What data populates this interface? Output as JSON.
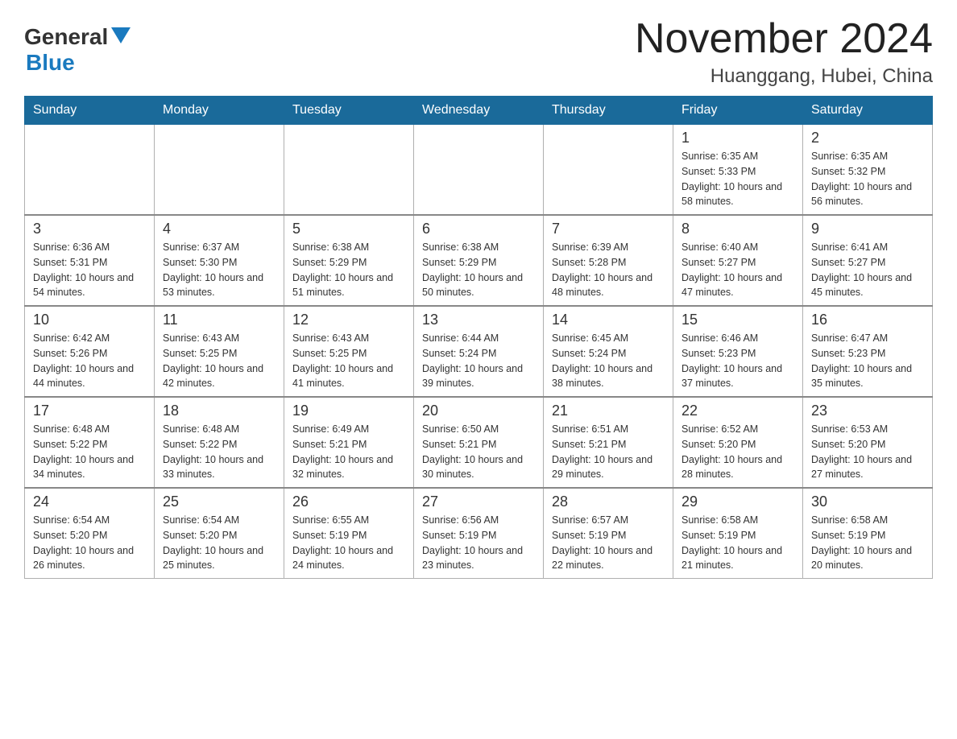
{
  "header": {
    "logo_general": "General",
    "logo_blue": "Blue",
    "month_title": "November 2024",
    "location": "Huanggang, Hubei, China"
  },
  "weekdays": [
    "Sunday",
    "Monday",
    "Tuesday",
    "Wednesday",
    "Thursday",
    "Friday",
    "Saturday"
  ],
  "weeks": [
    [
      {
        "day": "",
        "info": ""
      },
      {
        "day": "",
        "info": ""
      },
      {
        "day": "",
        "info": ""
      },
      {
        "day": "",
        "info": ""
      },
      {
        "day": "",
        "info": ""
      },
      {
        "day": "1",
        "info": "Sunrise: 6:35 AM\nSunset: 5:33 PM\nDaylight: 10 hours and 58 minutes."
      },
      {
        "day": "2",
        "info": "Sunrise: 6:35 AM\nSunset: 5:32 PM\nDaylight: 10 hours and 56 minutes."
      }
    ],
    [
      {
        "day": "3",
        "info": "Sunrise: 6:36 AM\nSunset: 5:31 PM\nDaylight: 10 hours and 54 minutes."
      },
      {
        "day": "4",
        "info": "Sunrise: 6:37 AM\nSunset: 5:30 PM\nDaylight: 10 hours and 53 minutes."
      },
      {
        "day": "5",
        "info": "Sunrise: 6:38 AM\nSunset: 5:29 PM\nDaylight: 10 hours and 51 minutes."
      },
      {
        "day": "6",
        "info": "Sunrise: 6:38 AM\nSunset: 5:29 PM\nDaylight: 10 hours and 50 minutes."
      },
      {
        "day": "7",
        "info": "Sunrise: 6:39 AM\nSunset: 5:28 PM\nDaylight: 10 hours and 48 minutes."
      },
      {
        "day": "8",
        "info": "Sunrise: 6:40 AM\nSunset: 5:27 PM\nDaylight: 10 hours and 47 minutes."
      },
      {
        "day": "9",
        "info": "Sunrise: 6:41 AM\nSunset: 5:27 PM\nDaylight: 10 hours and 45 minutes."
      }
    ],
    [
      {
        "day": "10",
        "info": "Sunrise: 6:42 AM\nSunset: 5:26 PM\nDaylight: 10 hours and 44 minutes."
      },
      {
        "day": "11",
        "info": "Sunrise: 6:43 AM\nSunset: 5:25 PM\nDaylight: 10 hours and 42 minutes."
      },
      {
        "day": "12",
        "info": "Sunrise: 6:43 AM\nSunset: 5:25 PM\nDaylight: 10 hours and 41 minutes."
      },
      {
        "day": "13",
        "info": "Sunrise: 6:44 AM\nSunset: 5:24 PM\nDaylight: 10 hours and 39 minutes."
      },
      {
        "day": "14",
        "info": "Sunrise: 6:45 AM\nSunset: 5:24 PM\nDaylight: 10 hours and 38 minutes."
      },
      {
        "day": "15",
        "info": "Sunrise: 6:46 AM\nSunset: 5:23 PM\nDaylight: 10 hours and 37 minutes."
      },
      {
        "day": "16",
        "info": "Sunrise: 6:47 AM\nSunset: 5:23 PM\nDaylight: 10 hours and 35 minutes."
      }
    ],
    [
      {
        "day": "17",
        "info": "Sunrise: 6:48 AM\nSunset: 5:22 PM\nDaylight: 10 hours and 34 minutes."
      },
      {
        "day": "18",
        "info": "Sunrise: 6:48 AM\nSunset: 5:22 PM\nDaylight: 10 hours and 33 minutes."
      },
      {
        "day": "19",
        "info": "Sunrise: 6:49 AM\nSunset: 5:21 PM\nDaylight: 10 hours and 32 minutes."
      },
      {
        "day": "20",
        "info": "Sunrise: 6:50 AM\nSunset: 5:21 PM\nDaylight: 10 hours and 30 minutes."
      },
      {
        "day": "21",
        "info": "Sunrise: 6:51 AM\nSunset: 5:21 PM\nDaylight: 10 hours and 29 minutes."
      },
      {
        "day": "22",
        "info": "Sunrise: 6:52 AM\nSunset: 5:20 PM\nDaylight: 10 hours and 28 minutes."
      },
      {
        "day": "23",
        "info": "Sunrise: 6:53 AM\nSunset: 5:20 PM\nDaylight: 10 hours and 27 minutes."
      }
    ],
    [
      {
        "day": "24",
        "info": "Sunrise: 6:54 AM\nSunset: 5:20 PM\nDaylight: 10 hours and 26 minutes."
      },
      {
        "day": "25",
        "info": "Sunrise: 6:54 AM\nSunset: 5:20 PM\nDaylight: 10 hours and 25 minutes."
      },
      {
        "day": "26",
        "info": "Sunrise: 6:55 AM\nSunset: 5:19 PM\nDaylight: 10 hours and 24 minutes."
      },
      {
        "day": "27",
        "info": "Sunrise: 6:56 AM\nSunset: 5:19 PM\nDaylight: 10 hours and 23 minutes."
      },
      {
        "day": "28",
        "info": "Sunrise: 6:57 AM\nSunset: 5:19 PM\nDaylight: 10 hours and 22 minutes."
      },
      {
        "day": "29",
        "info": "Sunrise: 6:58 AM\nSunset: 5:19 PM\nDaylight: 10 hours and 21 minutes."
      },
      {
        "day": "30",
        "info": "Sunrise: 6:58 AM\nSunset: 5:19 PM\nDaylight: 10 hours and 20 minutes."
      }
    ]
  ]
}
